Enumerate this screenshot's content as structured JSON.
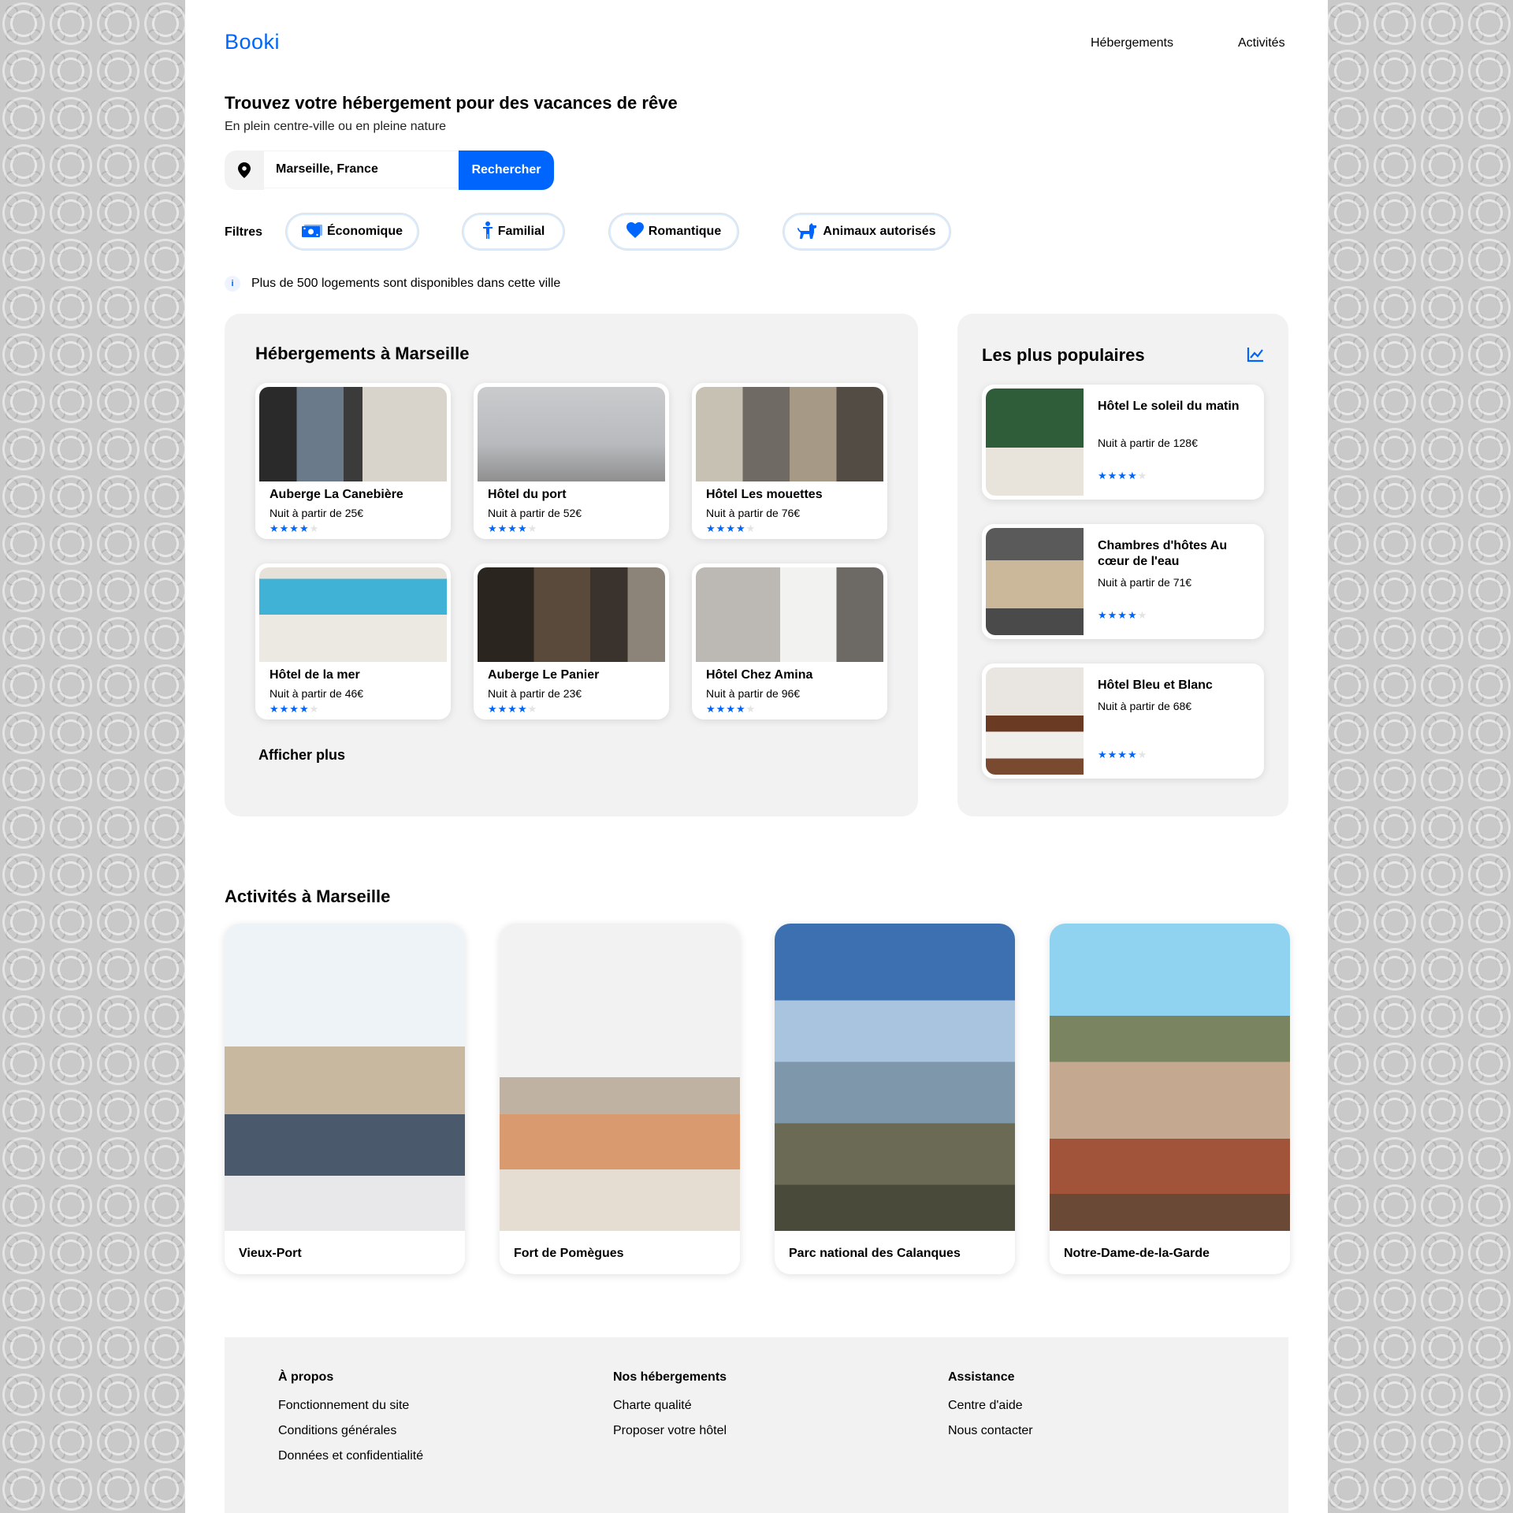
{
  "header": {
    "logo": "Booki",
    "nav": [
      "Hébergements",
      "Activités"
    ]
  },
  "hero": {
    "title": "Trouvez votre hébergement pour des vacances de rêve",
    "subtitle": "En plein centre-ville ou en pleine nature"
  },
  "search": {
    "value": "Marseille, France",
    "button": "Rechercher",
    "icon": "map-pin-icon"
  },
  "filters": {
    "label": "Filtres",
    "items": [
      {
        "label": "Économique",
        "icon": "money-icon"
      },
      {
        "label": "Familial",
        "icon": "child-icon"
      },
      {
        "label": "Romantique",
        "icon": "heart-icon"
      },
      {
        "label": "Animaux autorisés",
        "icon": "dog-icon"
      }
    ]
  },
  "info": "Plus de 500 logements sont disponibles dans cette ville",
  "accommodations": {
    "title": "Hébergements à Marseille",
    "show_more": "Afficher plus",
    "items": [
      {
        "name": "Auberge La Canebière",
        "price": "Nuit à partir de 25€",
        "rating": 4
      },
      {
        "name": "Hôtel du port",
        "price": "Nuit à partir de 52€",
        "rating": 4
      },
      {
        "name": "Hôtel Les mouettes",
        "price": "Nuit à partir de 76€",
        "rating": 4
      },
      {
        "name": "Hôtel de la mer",
        "price": "Nuit à partir de 46€",
        "rating": 4
      },
      {
        "name": "Auberge Le Panier",
        "price": "Nuit à partir de 23€",
        "rating": 4
      },
      {
        "name": "Hôtel Chez Amina",
        "price": "Nuit à partir de 96€",
        "rating": 4
      }
    ]
  },
  "popular": {
    "title": "Les plus populaires",
    "icon": "trend-chart-icon",
    "items": [
      {
        "name": "Hôtel Le soleil du matin",
        "price": "Nuit à partir de 128€",
        "rating": 4
      },
      {
        "name": "Chambres d'hôtes Au cœur de l'eau",
        "price": "Nuit à partir de 71€",
        "rating": 4
      },
      {
        "name": "Hôtel Bleu et Blanc",
        "price": "Nuit à partir de 68€",
        "rating": 4
      }
    ]
  },
  "activities": {
    "title": "Activités à Marseille",
    "items": [
      {
        "name": "Vieux-Port"
      },
      {
        "name": "Fort de Pomègues"
      },
      {
        "name": "Parc national des Calanques"
      },
      {
        "name": "Notre-Dame-de-la-Garde"
      }
    ]
  },
  "footer": {
    "columns": [
      {
        "title": "À propos",
        "links": [
          "Fonctionnement du site",
          "Conditions générales",
          "Données et confidentialité"
        ]
      },
      {
        "title": "Nos hébergements",
        "links": [
          "Charte qualité",
          "Proposer votre hôtel"
        ]
      },
      {
        "title": "Assistance",
        "links": [
          "Centre d'aide",
          "Nous contacter"
        ]
      }
    ]
  },
  "colors": {
    "primary": "#0065FC",
    "panel": "#F2F2F2",
    "star_off": "#E4E4E4"
  }
}
